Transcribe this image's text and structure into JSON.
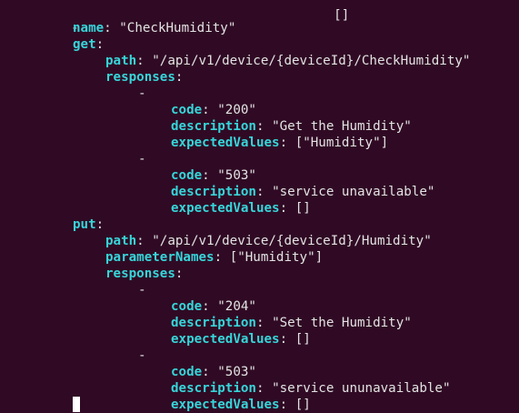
{
  "terminal": {
    "top_cut": {
      "dash": "-",
      "tail": "[]"
    },
    "item": {
      "name_key": "name",
      "name_value": "\"CheckHumidity\"",
      "get": {
        "key": "get",
        "path_key": "path",
        "path_value": "\"/api/v1/device/{deviceId}/CheckHumidity\"",
        "responses_key": "responses",
        "responses": [
          {
            "dash": "-",
            "code_key": "code",
            "code": "\"200\"",
            "desc_key": "description",
            "desc": "\"Get the Humidity\"",
            "ev_key": "expectedValues",
            "ev": "[\"Humidity\"]"
          },
          {
            "dash": "-",
            "code_key": "code",
            "code": "\"503\"",
            "desc_key": "description",
            "desc": "\"service unavailable\"",
            "ev_key": "expectedValues",
            "ev": "[]"
          }
        ]
      },
      "put": {
        "key": "put",
        "path_key": "path",
        "path_value": "\"/api/v1/device/{deviceId}/Humidity\"",
        "param_key": "parameterNames",
        "param_value": "[\"Humidity\"]",
        "responses_key": "responses",
        "responses": [
          {
            "dash": "-",
            "code_key": "code",
            "code": "\"204\"",
            "desc_key": "description",
            "desc": "\"Set the Humidity\"",
            "ev_key": "expectedValues",
            "ev": "[]"
          },
          {
            "dash": "-",
            "code_key": "code",
            "code": "\"503\"",
            "desc_key": "description",
            "desc": "\"service ununavailable\"",
            "ev_key": "expectedValues",
            "ev": "[]"
          }
        ]
      }
    },
    "colors": {
      "background": "#300a24",
      "key": "#36d5d9",
      "text": "#e3e3e3",
      "cursor": "#ffffff"
    }
  }
}
